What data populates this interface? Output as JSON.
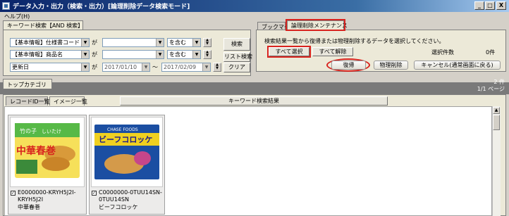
{
  "window": {
    "title": "データ入力・出力（検索・出力）[論理削除データ検索モード]",
    "minimize": "_",
    "maximize": "□",
    "close": "X"
  },
  "menu": {
    "help": "ヘルプ(H)"
  },
  "search": {
    "tab_label": "キーワード検索【AND 検索】",
    "rows": [
      {
        "field": "【基本情報】仕様書コード",
        "ga": "が",
        "value": "",
        "operator": "を含む"
      },
      {
        "field": "【基本情報】商品名",
        "ga": "が",
        "value": "",
        "operator": "を含む"
      }
    ],
    "date_row": {
      "field": "更新日",
      "ga": "が",
      "from": "2017/01/10",
      "tilde": "～",
      "to": "2017/02/09"
    },
    "buttons": {
      "search": "検索",
      "list_search": "リスト検索",
      "clear": "クリア"
    }
  },
  "right_tabs": {
    "bookmark": "ブックマーク",
    "maintenance": "論理削除メンテナンス"
  },
  "maintenance": {
    "instruction": "検索結果一覧から復帰または物理削除するデータを選択してください。",
    "select_all": "すべて選択",
    "deselect_all": "すべて解除",
    "selected_count_label": "選択件数",
    "selected_count": "0件",
    "restore": "復帰",
    "physical_delete": "物理削除",
    "cancel": "キャンセル(通常画面に戻る)"
  },
  "category": {
    "tab": "トップカテゴリ",
    "count": "2 件",
    "page": "1/1 ページ"
  },
  "results": {
    "tab_record": "レコードID一覧",
    "tab_image": "イメージ一覧",
    "header": "キーワード検索結果",
    "items": [
      {
        "code_line1": "E0000000-KRYH5J2I-",
        "code_line2": "KRYH5J2I",
        "name": "中華春巻",
        "checked": "✓",
        "product_text": "中華春巻",
        "product_text2": "竹の子",
        "product_text3": "しいたけ"
      },
      {
        "code_line1": "C0000000-0TUU14SN-",
        "code_line2": "0TUU14SN",
        "name": "ビーフコロッケ",
        "checked": "✓",
        "product_text": "ビーフコロッケ",
        "product_text2": "CHASE FOODS"
      }
    ]
  },
  "colors": {
    "accent_red": "#d8231e",
    "titlebar": "#0a246a"
  }
}
